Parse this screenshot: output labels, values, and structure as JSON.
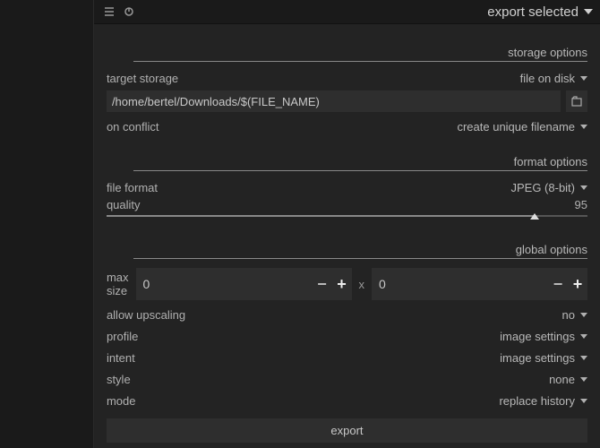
{
  "header": {
    "title": "export selected"
  },
  "sections": {
    "storage": "storage options",
    "format": "format options",
    "global": "global options"
  },
  "storage": {
    "target_label": "target storage",
    "target_value": "file on disk",
    "path": "/home/bertel/Downloads/$(FILE_NAME)",
    "conflict_label": "on conflict",
    "conflict_value": "create unique filename"
  },
  "format": {
    "file_format_label": "file format",
    "file_format_value": "JPEG (8-bit)",
    "quality_label": "quality",
    "quality_value": "95"
  },
  "global": {
    "max_size_label": "max size",
    "width": "0",
    "height": "0",
    "x": "x",
    "minus": "−",
    "plus": "+",
    "upscaling_label": "allow upscaling",
    "upscaling_value": "no",
    "profile_label": "profile",
    "profile_value": "image settings",
    "intent_label": "intent",
    "intent_value": "image settings",
    "style_label": "style",
    "style_value": "none",
    "mode_label": "mode",
    "mode_value": "replace history"
  },
  "export_button": "export"
}
